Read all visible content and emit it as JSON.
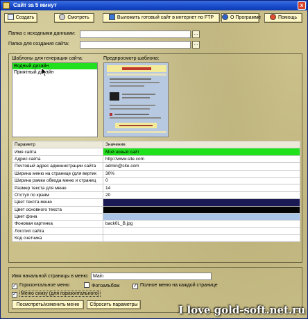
{
  "window": {
    "title": "Сайт за 5 минут",
    "close": "x"
  },
  "toolbar": {
    "create": "Создать",
    "view": "Смотреть",
    "publish": "Выложить готовый сайт в интернет по FTP",
    "about": "О Программе",
    "help": "Помощь"
  },
  "fields": {
    "source_label": "Папка с исходными данными:",
    "source_value": "",
    "output_label": "Папка для создания сайта:",
    "output_value": "",
    "browse": "..."
  },
  "templates": {
    "label": "Шаблоны для генерации сайта:",
    "items": [
      "Водный дизайн",
      "Приятный дизайн"
    ],
    "selected_index": 0,
    "preview_label": "Предпросмотр шаблона:"
  },
  "grid": {
    "headers": [
      "Параметр",
      "Значение"
    ],
    "rows": [
      [
        "Имя сайта",
        "Мой новый сайт"
      ],
      [
        "Адрес сайта",
        "http://www.site.com"
      ],
      [
        "Почтовый адрес администрации сайта",
        "admin@site.com"
      ],
      [
        "Ширина меню на странице (для вертик",
        "30%"
      ],
      [
        "Ширина рамки обвода меню и страниц",
        "0"
      ],
      [
        "Размер текста для меню",
        "14"
      ],
      [
        "Отступ по краям",
        "20"
      ],
      [
        "Цвет текста меню",
        ""
      ],
      [
        "Цвет основного текста",
        ""
      ],
      [
        "Цвет фона",
        ""
      ],
      [
        "Фоновая картинка",
        "back0L_B.jpg"
      ],
      [
        "Логотип сайта",
        ""
      ],
      [
        "Код счетчика",
        ""
      ]
    ],
    "swatches": {
      "text_menu": "#1c1a55",
      "main_text": "#050505",
      "background": "#a8c4e6"
    },
    "highlight_color": "#1fe11c"
  },
  "bottom": {
    "start_label": "Имя начальной страницы в меню:",
    "start_value": "Main",
    "checks": {
      "horizontal": {
        "label": "Горизонтальное меню",
        "checked": true
      },
      "photo": {
        "label": "Фотоальбом",
        "checked": false
      },
      "full_menu": {
        "label": "Полное меню на каждой странице",
        "checked": true
      },
      "bottom_menu": {
        "label": "Меню снизу (для горизонтального)",
        "checked": true
      }
    },
    "view_button": "Посмотреть/изменить меню",
    "reset_button": "Сбросить параметры"
  },
  "watermark": "I love gold-soft.net.ru"
}
